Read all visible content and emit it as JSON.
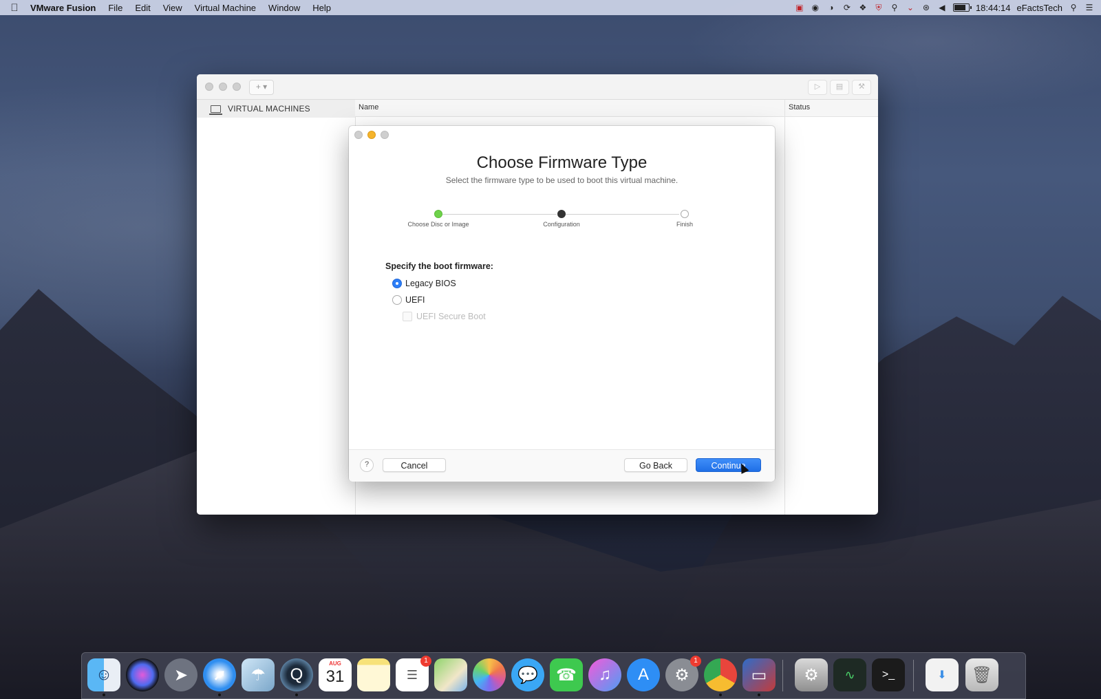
{
  "menubar": {
    "app_name": "VMware Fusion",
    "menus": [
      "File",
      "Edit",
      "View",
      "Virtual Machine",
      "Window",
      "Help"
    ],
    "clock": "18:44:14",
    "user": "eFactsTech"
  },
  "library": {
    "sidebar_header": "VIRTUAL MACHINES",
    "add_button": "+ ▾",
    "columns": {
      "name": "Name",
      "status": "Status"
    }
  },
  "dialog": {
    "title": "Choose Firmware Type",
    "subtitle": "Select the firmware type to be used to boot this virtual machine.",
    "steps": [
      {
        "label": "Choose Disc or Image",
        "state": "done"
      },
      {
        "label": "Configuration",
        "state": "current"
      },
      {
        "label": "Finish",
        "state": "todo"
      }
    ],
    "firmware_label": "Specify the boot firmware:",
    "options": [
      {
        "label": "Legacy BIOS",
        "selected": true
      },
      {
        "label": "UEFI",
        "selected": false
      }
    ],
    "secure_boot": {
      "label": "UEFI Secure Boot",
      "enabled": false,
      "checked": false
    },
    "help_label": "?",
    "cancel_label": "Cancel",
    "back_label": "Go Back",
    "continue_label": "Continue"
  },
  "dock": {
    "calendar": {
      "month": "AUG",
      "day": "31"
    },
    "badges": {
      "reminders": "1",
      "system_preferences": "1"
    },
    "apps": [
      "finder",
      "siri",
      "launchpad",
      "safari",
      "preview",
      "quicktime",
      "calendar",
      "notes",
      "reminders",
      "maps",
      "photos",
      "messages",
      "facetime",
      "itunes",
      "app-store",
      "system-preferences",
      "chrome",
      "vmware-fusion",
      "disk-utility",
      "activity-monitor",
      "terminal",
      "downloads",
      "trash"
    ]
  },
  "colors": {
    "accent": "#2d7ef7",
    "step_done": "#6ed24a",
    "step_current": "#333333",
    "badge": "#ee3b30"
  }
}
